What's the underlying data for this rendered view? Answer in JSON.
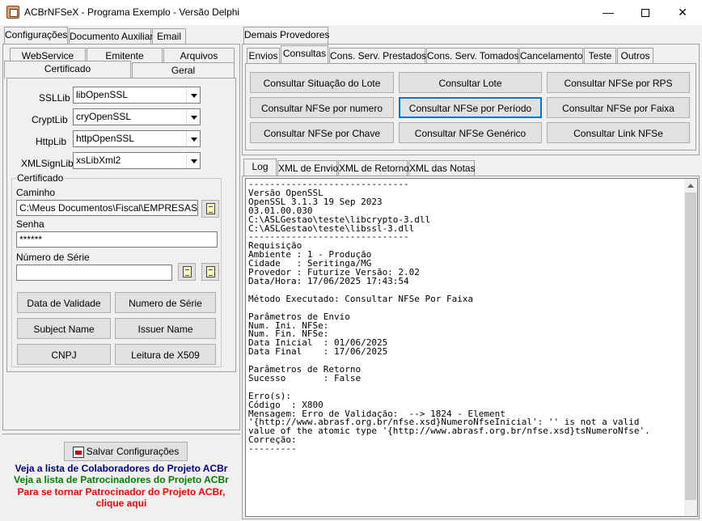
{
  "window": {
    "title": "ACBrNFSeX - Programa Exemplo - Versão Delphi"
  },
  "left": {
    "top_tabs": [
      "Configurações",
      "Documento Auxiliar",
      "Email"
    ],
    "sub_tabs_row1": [
      "WebService",
      "Emitente",
      "Arquivos"
    ],
    "sub_tabs_row2": [
      "Certificado",
      "Geral"
    ],
    "libs": [
      {
        "label": "SSLLib",
        "value": "libOpenSSL"
      },
      {
        "label": "CryptLib",
        "value": "cryOpenSSL"
      },
      {
        "label": "HttpLib",
        "value": "httpOpenSSL"
      },
      {
        "label": "XMLSignLib",
        "value": "xsLibXml2"
      }
    ],
    "certificado": {
      "group_title": "Certificado",
      "caminho_label": "Caminho",
      "caminho_value": "C:\\Meus Documentos\\Fiscal\\EMPRESAS\\BIANC",
      "senha_label": "Senha",
      "senha_value": "******",
      "serie_label": "Número de Série",
      "serie_value": "",
      "buttons": [
        "Data de Validade",
        "Numero de Série",
        "Subject Name",
        "Issuer Name",
        "CNPJ",
        "Leitura de X509"
      ]
    },
    "save_button": "Salvar Configurações",
    "links": {
      "colaboradores": "Veja a lista de Colaboradores do Projeto ACBr",
      "patrocinadores": "Veja a lista de Patrocinadores do Projeto ACBr",
      "patrocinador_line1": "Para se tornar Patrocinador do Projeto ACBr,",
      "patrocinador_line2": "clique aqui",
      "colors": {
        "colaboradores": "#000080",
        "patrocinadores": "#008000",
        "patrocinador": "#ff0000"
      }
    }
  },
  "right": {
    "top_tab": "Demais Provedores",
    "sub_tabs": [
      "Envios",
      "Consultas",
      "Cons. Serv. Prestados",
      "Cons. Serv. Tomados",
      "Cancelamento",
      "Teste",
      "Outros"
    ],
    "active_sub_tab": "Consultas",
    "buttons": [
      [
        "Consultar Situação do Lote",
        "Consultar Lote",
        "Consultar NFSe por RPS"
      ],
      [
        "Consultar NFSe por numero",
        "Consultar NFSe por Período",
        "Consultar NFSe por Faixa"
      ],
      [
        "Consultar NFSe por Chave",
        "Consultar NFSe Genérico",
        "Consultar Link NFSe"
      ]
    ],
    "focused_button": "Consultar NFSe por Período",
    "log_tabs": [
      "Log",
      "XML de Envio",
      "XML de Retorno",
      "XML das Notas"
    ],
    "log_lines": [
      "------------------------------",
      "Versão OpenSSL",
      "OpenSSL 3.1.3 19 Sep 2023",
      "03.01.00.030",
      "C:\\ASLGestao\\teste\\libcrypto-3.dll",
      "C:\\ASLGestao\\teste\\libssl-3.dll",
      "------------------------------",
      "Requisição",
      "Ambiente : 1 - Produção",
      "Cidade   : Seritinga/MG",
      "Provedor : Futurize Versão: 2.02",
      "Data/Hora: 17/06/2025 17:43:54",
      "",
      "Método Executado: Consultar NFSe Por Faixa",
      "",
      "Parâmetros de Envio",
      "Num. Ini. NFSe:",
      "Num. Fin. NFSe:",
      "Data Inicial  : 01/06/2025",
      "Data Final    : 17/06/2025",
      "",
      "Parâmetros de Retorno",
      "Sucesso       : False",
      "",
      "Erro(s):",
      "Código  : X800",
      "Mensagem: Erro de Validação:  --> 1824 - Element",
      "'{http://www.abrasf.org.br/nfse.xsd}NumeroNfseInicial': '' is not a valid",
      "value of the atomic type '{http://www.abrasf.org.br/nfse.xsd}tsNumeroNfse'.",
      "Correção:",
      "---------"
    ]
  }
}
